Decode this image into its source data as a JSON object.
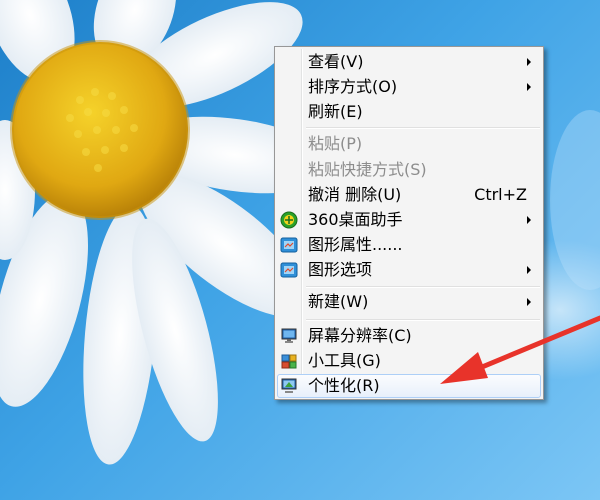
{
  "desktop": {
    "context_menu": {
      "items": [
        {
          "label": "查看(V)",
          "submenu": true
        },
        {
          "label": "排序方式(O)",
          "submenu": true
        },
        {
          "label": "刷新(E)"
        },
        {
          "label": "粘贴(P)",
          "disabled": true
        },
        {
          "label": "粘贴快捷方式(S)",
          "disabled": true
        },
        {
          "label": "撤消 删除(U)",
          "shortcut": "Ctrl+Z"
        },
        {
          "label": "360桌面助手",
          "submenu": true,
          "icon": "360-icon"
        },
        {
          "label": "图形属性......",
          "icon": "graphics-properties-icon"
        },
        {
          "label": "图形选项",
          "submenu": true,
          "icon": "graphics-options-icon"
        },
        {
          "label": "新建(W)",
          "submenu": true
        },
        {
          "label": "屏幕分辨率(C)",
          "icon": "monitor-icon"
        },
        {
          "label": "小工具(G)",
          "icon": "gadgets-icon"
        },
        {
          "label": "个性化(R)",
          "icon": "personalize-icon",
          "highlighted": true
        }
      ]
    },
    "annotation": {
      "color": "#e8332a"
    }
  }
}
